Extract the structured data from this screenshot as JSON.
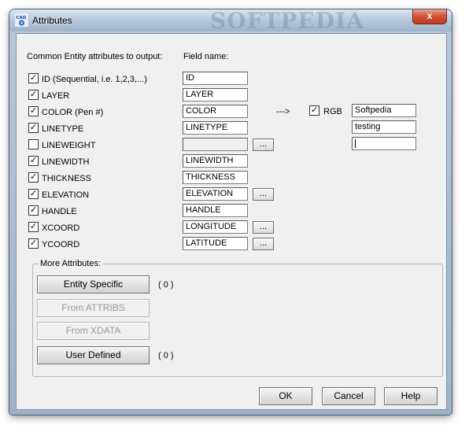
{
  "window": {
    "title": "Attributes",
    "watermark": "SOFTPEDIA",
    "close_label": "x"
  },
  "headers": {
    "common": "Common Entity attributes to output:",
    "field_name": "Field name:"
  },
  "rows": [
    {
      "label": "ID (Sequential, i.e. 1,2,3,...)",
      "checked": true,
      "field": "ID",
      "button": false,
      "field_enabled": true
    },
    {
      "label": "LAYER",
      "checked": true,
      "field": "LAYER",
      "button": false,
      "field_enabled": true
    },
    {
      "label": "COLOR (Pen #)",
      "checked": true,
      "field": "COLOR",
      "button": false,
      "field_enabled": true
    },
    {
      "label": "LINETYPE",
      "checked": true,
      "field": "LINETYPE",
      "button": false,
      "field_enabled": true
    },
    {
      "label": "LINEWEIGHT",
      "checked": false,
      "field": "",
      "button": true,
      "field_enabled": false
    },
    {
      "label": "LINEWIDTH",
      "checked": true,
      "field": "LINEWIDTH",
      "button": false,
      "field_enabled": true
    },
    {
      "label": "THICKNESS",
      "checked": true,
      "field": "THICKNESS",
      "button": false,
      "field_enabled": true
    },
    {
      "label": "ELEVATION",
      "checked": true,
      "field": "ELEVATION",
      "button": true,
      "field_enabled": true
    },
    {
      "label": "HANDLE",
      "checked": true,
      "field": "HANDLE",
      "button": false,
      "field_enabled": true
    },
    {
      "label": "XCOORD",
      "checked": true,
      "field": "LONGITUDE",
      "button": true,
      "field_enabled": true
    },
    {
      "label": "YCOORD",
      "checked": true,
      "field": "LATITUDE",
      "button": true,
      "field_enabled": true
    }
  ],
  "dots_label": "...",
  "rgb": {
    "arrow": "--->",
    "label": "RGB",
    "checked": true,
    "fields": [
      "Softpedia",
      "testing",
      ""
    ]
  },
  "more": {
    "title": "More Attributes:",
    "buttons": [
      {
        "label": "Entity Specific",
        "enabled": true,
        "count": "( 0 )"
      },
      {
        "label": "From ATTRIBS",
        "enabled": false,
        "count": ""
      },
      {
        "label": "From XDATA",
        "enabled": false,
        "count": ""
      },
      {
        "label": "User Defined",
        "enabled": true,
        "count": "( 0 )"
      }
    ]
  },
  "footer": {
    "ok": "OK",
    "cancel": "Cancel",
    "help": "Help"
  }
}
